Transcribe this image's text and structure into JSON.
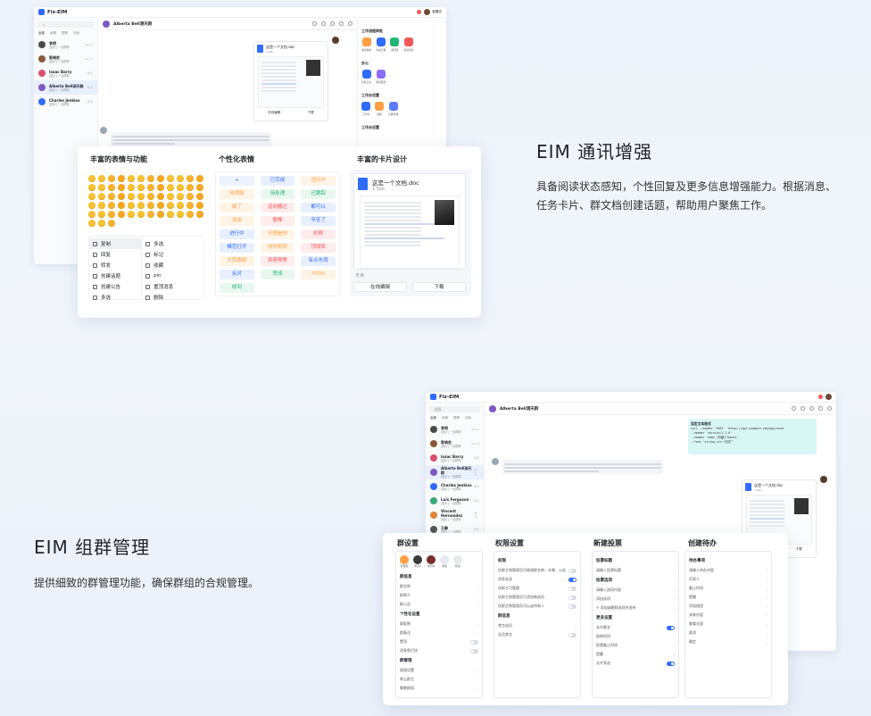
{
  "app": {
    "name": "Fiz-EIM"
  },
  "colors": {
    "accent": "#2f6bff",
    "orange": "#ff9f43",
    "green": "#22b573",
    "purple": "#8e6cff",
    "red": "#f25757"
  },
  "top_window": {
    "user": "赵雅文",
    "chat_title": "Alberta Bell测天群",
    "tabs": [
      "全部",
      "私聊",
      "群聊",
      "@我",
      "未读"
    ],
    "contacts": [
      {
        "name": "李明",
        "sub": "[图片] 一加群聊",
        "time": "09:32",
        "color": "#4a4a4a"
      },
      {
        "name": "陈晓宏",
        "sub": "[图片] 一加群聊",
        "time": "09:13",
        "color": "#8b5a3c"
      },
      {
        "name": "Isaac Barry",
        "sub": "[图片] 一加群聊",
        "time": "昨天",
        "color": "#d94f6d"
      },
      {
        "name": "Alberta Bell测天群",
        "sub": "[图片] 一加群聊",
        "time": "昨天",
        "color": "#7e57c2"
      },
      {
        "name": "Charles Jenkins",
        "sub": "[图片] 一加群聊",
        "time": "昨天",
        "color": "#2f6bff"
      }
    ],
    "workbench": {
      "title": "工作流程审批",
      "items": [
        "阅读审批",
        "查看日程",
        "通讯录",
        "新闻消息"
      ],
      "office_title": "办公",
      "office_items": [
        "智能云文",
        "规划报告"
      ],
      "platform_title": "工作台设置",
      "platform_items": [
        "工作室",
        "视频",
        "日程管理"
      ],
      "extra_title": "工作台设置"
    },
    "file_card": {
      "name": "这是一个文档.doc",
      "size": "1.5kb",
      "btn1": "在线编辑",
      "btn2": "下载"
    }
  },
  "feature_panel": {
    "col1_title": "丰富的表情与功能",
    "col2_title": "个性化表情",
    "col3_title": "丰富的卡片设计",
    "menu_left": [
      "复制",
      "回复",
      "转发",
      "创建话题",
      "创建公告",
      "多选"
    ],
    "menu_right": [
      "多选",
      "标记",
      "收藏",
      "pin",
      "置顶消息",
      "删除"
    ],
    "tags": [
      {
        "text": "+",
        "bg": "#eef3ff",
        "fg": "#2f6bff"
      },
      {
        "text": "已完成",
        "bg": "#e8f0ff",
        "fg": "#2f6bff"
      },
      {
        "text": "进行中",
        "bg": "#fff4e6",
        "fg": "#ff9f43"
      },
      {
        "text": "待领取",
        "bg": "#fff4e6",
        "fg": "#ff9f43"
      },
      {
        "text": "待处理",
        "bg": "#e9f8ef",
        "fg": "#22b573"
      },
      {
        "text": "已跟踪",
        "bg": "#e9f8ef",
        "fg": "#22b573"
      },
      {
        "text": "搞了",
        "bg": "#fff4e6",
        "fg": "#ff9f43"
      },
      {
        "text": "返岗搬迁",
        "bg": "#ffecec",
        "fg": "#f25757"
      },
      {
        "text": "都可以",
        "bg": "#e8f0ff",
        "fg": "#2f6bff"
      },
      {
        "text": "加油",
        "bg": "#fff4e6",
        "fg": "#ff9f43"
      },
      {
        "text": "狠棒",
        "bg": "#ffecec",
        "fg": "#f25757"
      },
      {
        "text": "辛苦了",
        "bg": "#e8f0ff",
        "fg": "#2f6bff"
      },
      {
        "text": "进行中",
        "bg": "#e8f0ff",
        "fg": "#2f6bff"
      },
      {
        "text": "不愧是你",
        "bg": "#fff4e6",
        "fg": "#ff9f43"
      },
      {
        "text": "妙啊",
        "bg": "#ffecec",
        "fg": "#f25757"
      },
      {
        "text": "模范打开",
        "bg": "#e8f0ff",
        "fg": "#2f6bff"
      },
      {
        "text": "热烈祝贺",
        "bg": "#fff4e6",
        "fg": "#ff9f43"
      },
      {
        "text": "顶呱呱",
        "bg": "#ffecec",
        "fg": "#f25757"
      },
      {
        "text": "大受震撼",
        "bg": "#fff4e6",
        "fg": "#ff9f43"
      },
      {
        "text": "卖萌预警",
        "bg": "#ffecec",
        "fg": "#f25757"
      },
      {
        "text": "有点东西",
        "bg": "#e8f0ff",
        "fg": "#2f6bff"
      },
      {
        "text": "反对",
        "bg": "#e8f0ff",
        "fg": "#2f6bff"
      },
      {
        "text": "赞成",
        "bg": "#e9f8ef",
        "fg": "#22b573"
      },
      {
        "text": "YYDS",
        "bg": "#fff4e6",
        "fg": "#ff9f43"
      },
      {
        "text": "收到",
        "bg": "#e9f8ef",
        "fg": "#22b573"
      }
    ],
    "card": {
      "name": "这是一个文档.doc",
      "size": "1.5kb",
      "btn1": "在线编辑",
      "btn2": "下载",
      "read": "未读"
    }
  },
  "section1": {
    "title": "EIM 通讯增强",
    "desc": "具备阅读状态感知，个性回复及更多信息增强能力。根据消息、任务卡片、群文档创建话题，帮助用户聚焦工作。"
  },
  "section2": {
    "title": "EIM 组群管理",
    "desc": "提供细致的群管理功能，确保群组的合规管理。"
  },
  "bottom_window": {
    "search_placeholder": "搜索",
    "chat_title": "Alberta Bell测天群",
    "contacts": [
      {
        "name": "李明",
        "sub": "[图片] 一加群聊",
        "time": "09:32",
        "color": "#4a4a4a"
      },
      {
        "name": "陈晓宏",
        "sub": "[图片] 一加群聊",
        "time": "09:13",
        "color": "#8b5a3c"
      },
      {
        "name": "Isaac Barry",
        "sub": "[图片] 一加群聊",
        "time": "昨天",
        "color": "#d94f6d"
      },
      {
        "name": "Alberta Bell测天群",
        "sub": "[图片] 一加群聊",
        "time": "昨天",
        "color": "#7e57c2"
      },
      {
        "name": "Charles Jenkins",
        "sub": "[图片] 一加群聊",
        "time": "昨天",
        "color": "#2f6bff"
      },
      {
        "name": "Luis Ferguson",
        "sub": "[图片] 一加群聊",
        "time": "昨天",
        "color": "#3aa876"
      },
      {
        "name": "Vincent Hernandez",
        "sub": "[图片] 一加群聊",
        "time": "昨天",
        "color": "#e0833a"
      },
      {
        "name": "王静",
        "sub": "[图片] 一加群聊",
        "time": "昨天",
        "color": "#555"
      }
    ],
    "code_title": "设定文本格式",
    "code_lines": [
      "curl --header 'POST' 'https://api.example.com/app/send'",
      "--header 'version:2.1.0'",
      "--header 'name (机器人Token)'",
      "--form 'string_str:\"测试\"'"
    ],
    "file_card": {
      "name": "这是一个文档.doc",
      "size": "1.5kb",
      "btn1": "在线编辑",
      "btn2": "下载"
    }
  },
  "group_panel": {
    "col1_title": "群设置",
    "col2_title": "权限设置",
    "col3_title": "新建投票",
    "col4_title": "创建待办",
    "members": [
      "管理员",
      "成员A",
      "成员B",
      "添加",
      "移出"
    ],
    "group_rows": [
      "群信息",
      "群名称",
      "群简介",
      "群公告",
      "个性化设置",
      "群昵称",
      "群备注",
      "置顶",
      "消息免打扰",
      "群管理",
      "权限设置",
      "转让群主",
      "解散群组"
    ],
    "perm_rows": [
      "权限",
      "仅群主和管理员可修改群名称、头像、公告",
      "消息发送",
      "仅群主可管理",
      "仅群主和管理员可添加新成员",
      "仅群主和管理员可以@所有人",
      "群信息",
      "禁言成员",
      "全员禁言"
    ],
    "vote_rows": [
      "投票标题",
      "请输入投票标题",
      "投票选项",
      "请输入选项内容",
      "添加选项",
      "+ 添加或删除选项并发布",
      "更多设置",
      "允许匿名",
      "结束时间",
      "投票截止时间",
      "提醒",
      "允许多选"
    ],
    "todo_rows": [
      "待办事项",
      "请输入待办内容",
      "负责人",
      "截止时间",
      "提醒",
      "添加描述",
      "关联内容",
      "查看全部",
      "取消",
      "确定"
    ]
  }
}
